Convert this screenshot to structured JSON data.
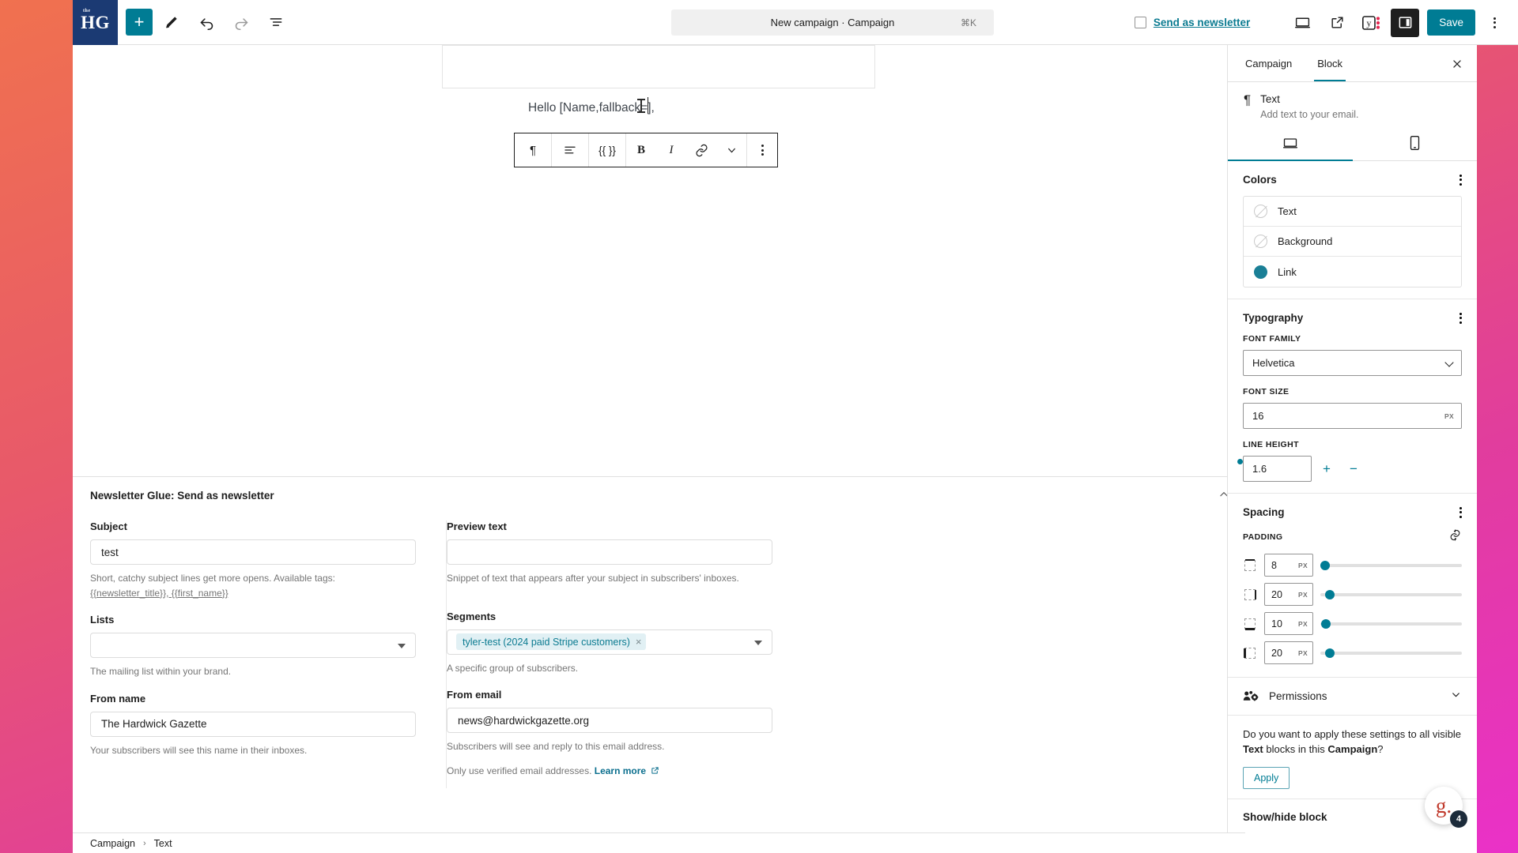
{
  "brand": {
    "logo_text": "HG",
    "accent": "#007c94",
    "link_color": "#0b7b91"
  },
  "topbar": {
    "add_block_label": "+",
    "icons": [
      "pencil-icon",
      "undo-icon",
      "redo-icon",
      "list-view-icon"
    ],
    "command_bar": {
      "title": "New campaign · Campaign",
      "shortcut": "⌘K"
    },
    "send_as_newsletter_label": "Send as newsletter",
    "send_as_newsletter_checked": false,
    "right_icons": [
      "desktop-preview-icon",
      "view-external-icon",
      "yoast-seo-icon",
      "sidebar-toggle-icon"
    ],
    "save_label": "Save",
    "options_label": "Options"
  },
  "editor": {
    "block_text": "Hello [Name,fallback=],",
    "toolbar": {
      "paragraph_label": "¶",
      "align_label": "align-icon",
      "merge_tag_label": "{{ }}",
      "bold_label": "B",
      "italic_label": "I",
      "link_label": "link-icon",
      "more_label": "chevron-down-icon",
      "options_label": "kebab-icon"
    }
  },
  "newsletter_glue": {
    "panel_title": "Newsletter Glue: Send as newsletter",
    "fields": {
      "subject": {
        "label": "Subject",
        "value": "test",
        "placeholder": "",
        "help": "Short, catchy subject lines get more opens. Available tags:",
        "help_tags": "{{newsletter_title}}, {{first_name}}"
      },
      "preview_text": {
        "label": "Preview text",
        "value": "",
        "placeholder": "",
        "help": "Snippet of text that appears after your subject in subscribers' inboxes."
      },
      "lists": {
        "label": "Lists",
        "value": "",
        "help": "The mailing list within your brand."
      },
      "segments": {
        "label": "Segments",
        "chip": "tyler-test (2024 paid Stripe customers)",
        "remove_label": "×",
        "help": "A specific group of subscribers."
      },
      "from_name": {
        "label": "From name",
        "value": "The Hardwick Gazette",
        "help": "Your subscribers will see this name in their inboxes."
      },
      "from_email": {
        "label": "From email",
        "value": "news@hardwickgazette.org",
        "help": "Subscribers will see and reply to this email address.",
        "help2_prefix": "Only use verified email addresses. ",
        "help2_link": "Learn more"
      }
    }
  },
  "sidebar": {
    "tabs": [
      {
        "label": "Campaign",
        "active": false
      },
      {
        "label": "Block",
        "active": true
      }
    ],
    "close_label": "✕",
    "block": {
      "icon": "¶",
      "name": "Text",
      "description": "Add text to your email."
    },
    "device_tabs": [
      {
        "name": "desktop-view-tab",
        "active": true
      },
      {
        "name": "mobile-view-tab",
        "active": false
      }
    ],
    "colors": {
      "title": "Colors",
      "rows": [
        {
          "label": "Text",
          "value": "",
          "filled": false
        },
        {
          "label": "Background",
          "value": "",
          "filled": false
        },
        {
          "label": "Link",
          "value": "#1a7f96",
          "filled": true
        }
      ]
    },
    "typography": {
      "title": "Typography",
      "font_family_label": "FONT FAMILY",
      "font_family_value": "Helvetica",
      "font_size_label": "FONT SIZE",
      "font_size_value": "16",
      "font_size_unit": "PX",
      "line_height_label": "LINE HEIGHT",
      "line_height_value": "1.6",
      "increase_label": "+",
      "decrease_label": "−"
    },
    "spacing": {
      "title": "Spacing",
      "padding_label": "PADDING",
      "link_sides_label": "unlink-sides-icon",
      "sides": [
        {
          "name": "padding-top",
          "value": "8",
          "unit": "PX",
          "pct": 7
        },
        {
          "name": "padding-right",
          "value": "20",
          "unit": "PX",
          "pct": 13
        },
        {
          "name": "padding-bottom",
          "value": "10",
          "unit": "PX",
          "pct": 8
        },
        {
          "name": "padding-left",
          "value": "20",
          "unit": "PX",
          "pct": 13
        }
      ]
    },
    "permissions": {
      "label": "Permissions"
    },
    "apply_panel": {
      "text_before": "Do you want to apply these settings to all visible ",
      "bold1": "Text",
      "text_middle": " blocks in this ",
      "bold2": "Campaign",
      "text_after": "?",
      "button_label": "Apply"
    },
    "show_hide": {
      "label": "Show/hide block"
    }
  },
  "breadcrumb": {
    "items": [
      "Campaign",
      "Text"
    ],
    "separator": "›"
  },
  "grammarly": {
    "glyph": "g.",
    "count": "4"
  }
}
